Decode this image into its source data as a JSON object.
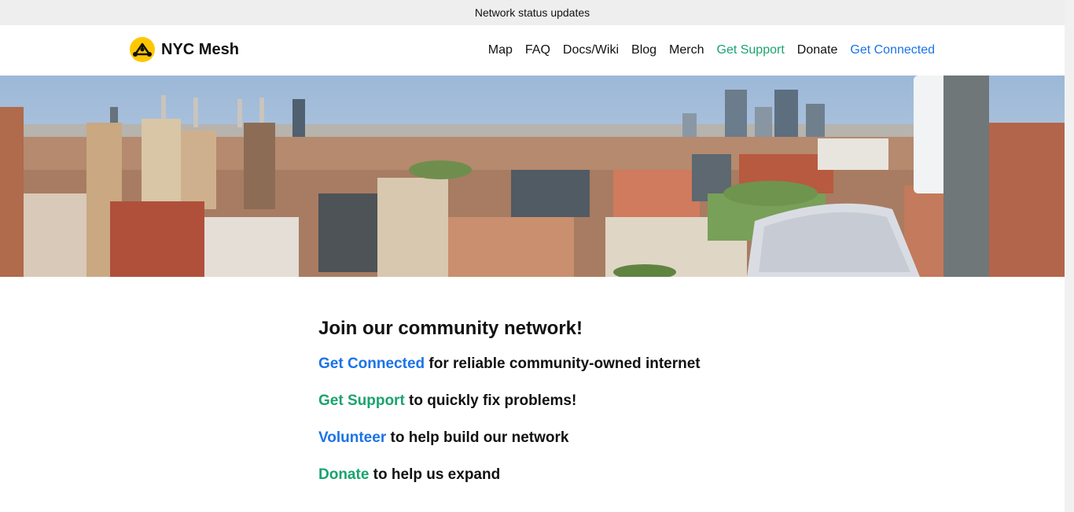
{
  "status_bar": {
    "text": "Network status updates"
  },
  "header": {
    "brand": "NYC Mesh",
    "logo_icon": "nyc-mesh-logo",
    "nav": [
      {
        "label": "Map",
        "color": "default"
      },
      {
        "label": "FAQ",
        "color": "default"
      },
      {
        "label": "Docs/Wiki",
        "color": "default"
      },
      {
        "label": "Blog",
        "color": "default"
      },
      {
        "label": "Merch",
        "color": "default"
      },
      {
        "label": "Get Support",
        "color": "green"
      },
      {
        "label": "Donate",
        "color": "default"
      },
      {
        "label": "Get Connected",
        "color": "blue"
      }
    ]
  },
  "hero": {
    "image": "nyc-skyline-with-rooftop-antenna"
  },
  "main": {
    "heading": "Join our community network!",
    "lines": [
      {
        "link": "Get Connected",
        "text": " for reliable community-owned internet",
        "color": "blue"
      },
      {
        "link": "Get Support",
        "text": " to quickly fix problems!",
        "color": "green"
      },
      {
        "link": "Volunteer",
        "text": " to help build our network",
        "color": "blue"
      },
      {
        "link": "Donate",
        "text": " to help us expand",
        "color": "green"
      }
    ]
  },
  "colors": {
    "accent_blue": "#1a73e8",
    "accent_green": "#1aa36f",
    "logo_yellow": "#ffc700"
  }
}
